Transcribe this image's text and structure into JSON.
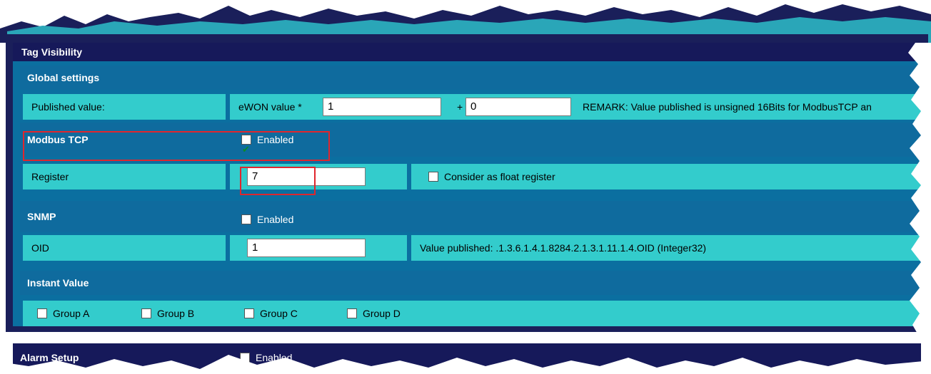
{
  "panel": {
    "title": "Tag Visibility"
  },
  "global_settings": {
    "title": "Global settings",
    "published_value_label": "Published value:",
    "ewon_value_label": "eWON value *",
    "multiplier_value": "1",
    "plus_label": "+",
    "offset_value": "0",
    "remark": "REMARK: Value published is unsigned 16Bits for ModbusTCP an"
  },
  "modbus_tcp": {
    "title": "Modbus TCP",
    "enabled_label": "Enabled",
    "enabled": true,
    "register_label": "Register",
    "register_value": "7",
    "float_label": "Consider as float register"
  },
  "snmp": {
    "title": "SNMP",
    "enabled_label": "Enabled",
    "enabled": false,
    "oid_label": "OID",
    "oid_value": "1",
    "value_published": "Value published: .1.3.6.1.4.1.8284.2.1.3.1.11.1.4.OID (Integer32)"
  },
  "instant_value": {
    "title": "Instant Value",
    "groups": [
      "Group A",
      "Group B",
      "Group C",
      "Group D"
    ]
  },
  "alarm_setup": {
    "title": "Alarm Setup",
    "enabled_label": "Enabled"
  },
  "colors": {
    "dark_navy": "#1a1f5a",
    "section_blue": "#0f6b9e",
    "cell_cyan": "#33cccc",
    "highlight_red": "#e0262d"
  }
}
